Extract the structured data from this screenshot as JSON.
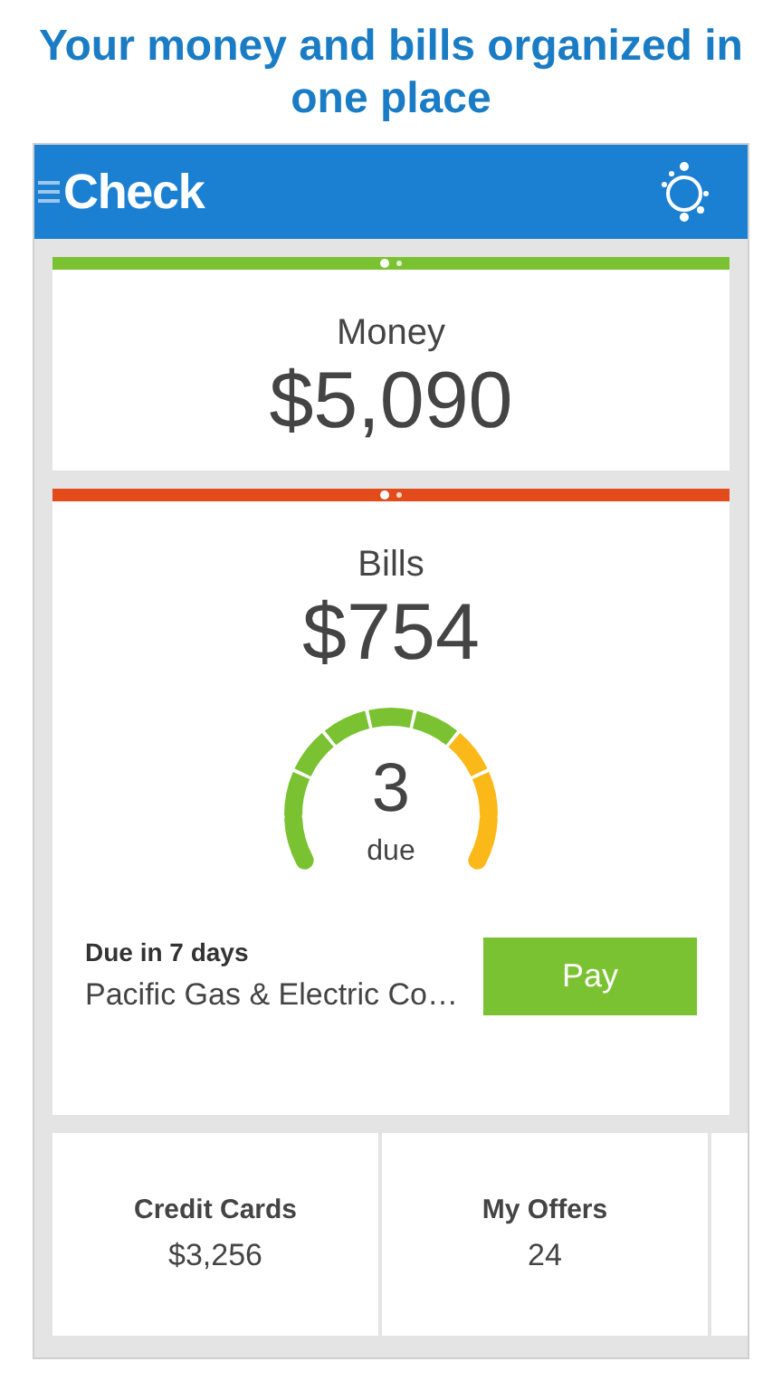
{
  "headline": "Your money and bills organized in one place",
  "app_bar": {
    "logo": "Check"
  },
  "money_card": {
    "dots": [
      {
        "selected": true
      },
      {
        "selected": false
      }
    ],
    "title": "Money",
    "amount": "$5,090"
  },
  "bills_card": {
    "dots": [
      {
        "selected": true
      },
      {
        "selected": false
      }
    ],
    "title": "Bills",
    "amount": "$754",
    "gauge": {
      "count": "3",
      "label": "due",
      "segments": [
        {
          "color": "#7ac231"
        },
        {
          "color": "#7ac231"
        },
        {
          "color": "#7ac231"
        },
        {
          "color": "#7ac231"
        },
        {
          "color": "#7ac231"
        },
        {
          "color": "#7ac231"
        },
        {
          "color": "#fbb919"
        },
        {
          "color": "#fbb919"
        },
        {
          "color": "#fbb919"
        }
      ]
    },
    "next_bill": {
      "due": "Due in 7 days",
      "payee": "Pacific Gas & Electric Co…"
    },
    "pay_button": "Pay"
  },
  "tiles": [
    {
      "title": "Credit Cards",
      "value": "$3,256"
    },
    {
      "title": "My Offers",
      "value": "24"
    }
  ]
}
